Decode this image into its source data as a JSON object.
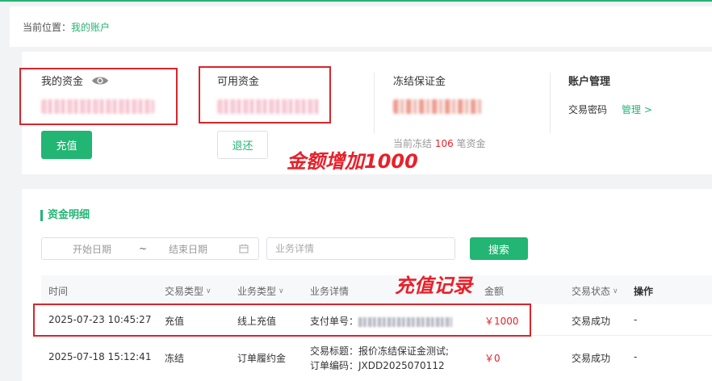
{
  "breadcrumb": {
    "prefix": "当前位置：",
    "current": "我的账户"
  },
  "account": {
    "my_funds": {
      "label": "我的资金",
      "recharge_button": "充值"
    },
    "available": {
      "label": "可用资金",
      "withdraw_button": "退还"
    },
    "frozen": {
      "label": "冻结保证金",
      "note_prefix": "当前冻结 ",
      "count": "106",
      "note_suffix": " 笔资金"
    },
    "management": {
      "title": "账户管理",
      "password_label": "交易密码",
      "manage_link": "管理 >"
    }
  },
  "annotations": {
    "amount_increase": "金额增加1000",
    "recharge_record": "充值记录"
  },
  "details": {
    "title": "资金明细",
    "start_date_placeholder": "开始日期",
    "range_separator": "~",
    "end_date_placeholder": "结束日期",
    "business_placeholder": "业务详情",
    "search_button": "搜索",
    "columns": {
      "time": "时间",
      "trade_type": "交易类型",
      "business_type": "业务类型",
      "business_detail": "业务详情",
      "amount": "金额",
      "status": "交易状态",
      "action": "操作"
    },
    "rows": [
      {
        "time": "2025-07-23 10:45:27",
        "trade_type": "充值",
        "business_type": "线上充值",
        "detail_line1": "支付单号：",
        "detail_line2": "",
        "amount": "￥1000",
        "status": "交易成功",
        "action": "-"
      },
      {
        "time": "2025-07-18 15:12:41",
        "trade_type": "冻结",
        "business_type": "订单履约金",
        "detail_line1": "交易标题：报价冻结保证金测试;",
        "detail_line2": "订单编码：JXDD2025070112",
        "amount": "￥0",
        "status": "交易成功",
        "action": "-"
      }
    ]
  },
  "colors": {
    "brand_green": "#22b573",
    "alert_red": "#e8202a",
    "box_red": "#d9252b"
  }
}
